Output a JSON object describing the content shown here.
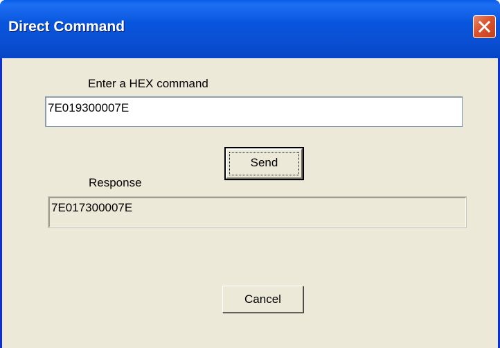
{
  "window": {
    "title": "Direct Command"
  },
  "icons": {
    "close": "close-icon"
  },
  "colors": {
    "titlebar": "#0855dd",
    "client_bg": "#ece9d8",
    "close_button": "#d9542e"
  },
  "form": {
    "command_label": "Enter a HEX command",
    "command_value": "7E019300007E",
    "send_label": "Send",
    "response_label": "Response",
    "response_value": "7E017300007E",
    "cancel_label": "Cancel"
  }
}
